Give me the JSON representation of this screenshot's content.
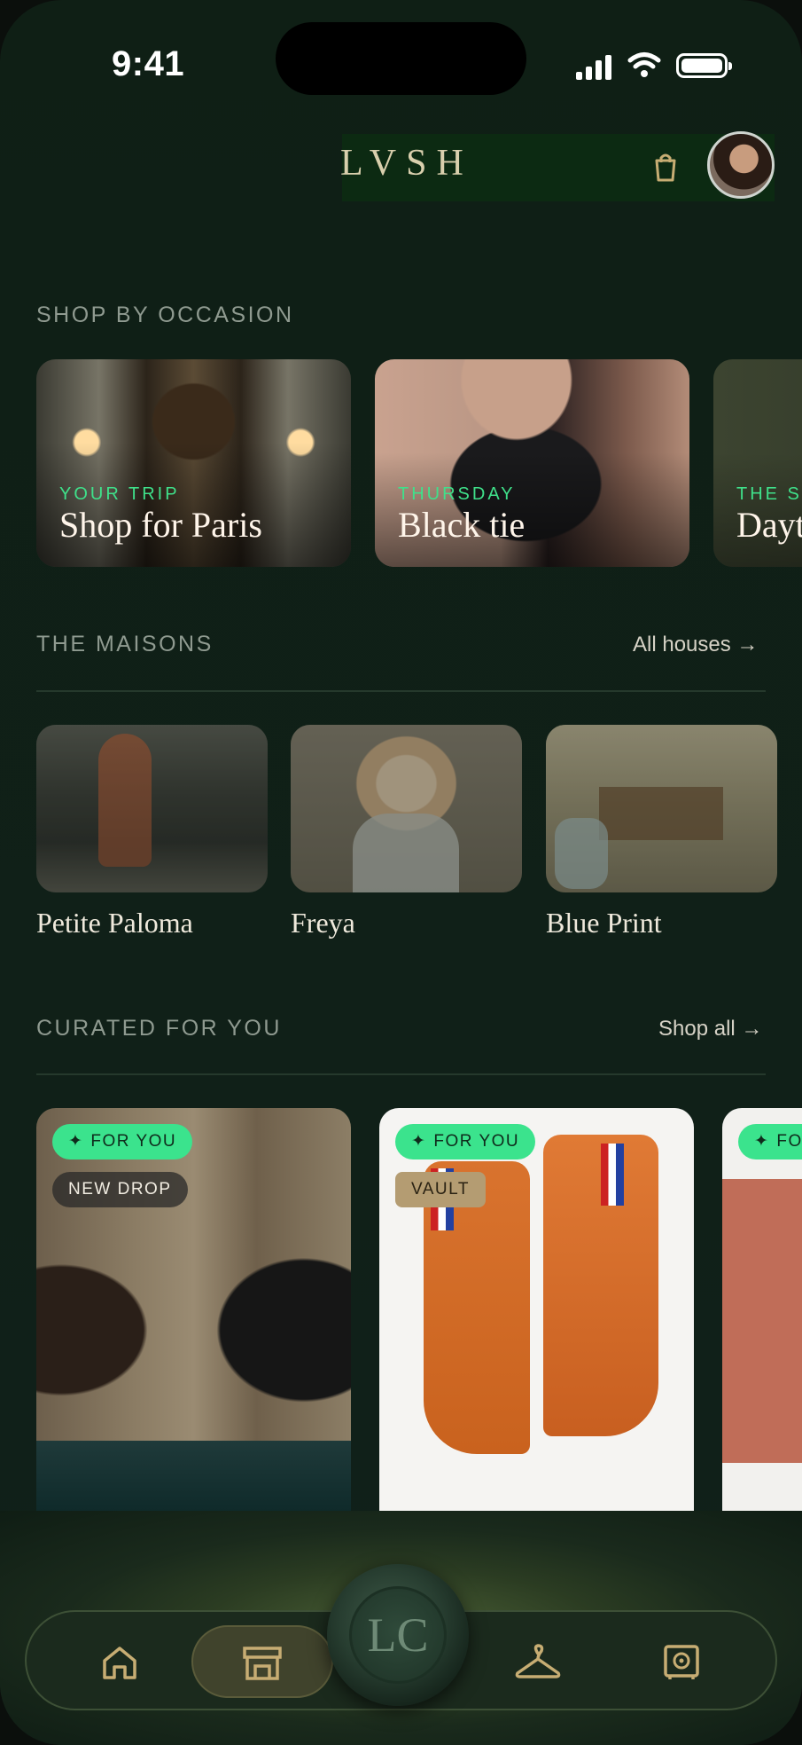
{
  "status": {
    "time": "9:41"
  },
  "header": {
    "logo": "LVSH"
  },
  "occasion": {
    "title": "SHOP BY OCCASION",
    "cards": [
      {
        "kicker": "YOUR TRIP",
        "title": "Shop for Paris"
      },
      {
        "kicker": "THURSDAY",
        "title": "Black tie"
      },
      {
        "kicker": "THE S",
        "title": "Dayt"
      }
    ]
  },
  "maisons": {
    "title": "THE MAISONS",
    "link": "All houses →",
    "items": [
      {
        "name": "Petite Paloma"
      },
      {
        "name": "Freya"
      },
      {
        "name": "Blue Print"
      }
    ]
  },
  "curated": {
    "title": "CURATED FOR YOU",
    "link": "Shop all →",
    "products": [
      {
        "badge": "FOR YOU",
        "tag": "NEW DROP"
      },
      {
        "badge": "FOR YOU",
        "tag": "VAULT"
      },
      {
        "badge": "FO"
      }
    ]
  },
  "nav": {
    "seal_text": "LC",
    "items": [
      "home-icon",
      "storefront-icon",
      "hanger-icon",
      "vault-icon"
    ]
  },
  "colors": {
    "accent": "#3be38d",
    "gold": "#d9cfad",
    "background": "#10201a"
  }
}
